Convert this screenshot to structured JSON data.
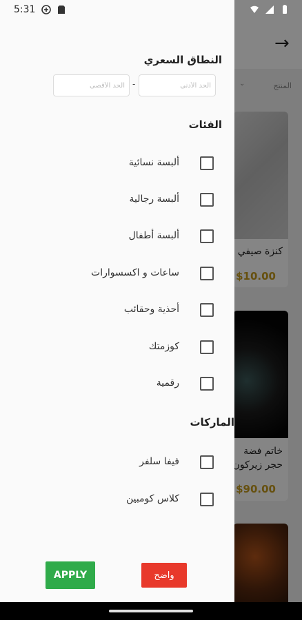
{
  "status_bar": {
    "time": "5:31",
    "left_icons": [
      "gamepad-icon",
      "sim-card-icon"
    ],
    "right_icons": [
      "wifi-icon",
      "cellular-signal-icon",
      "battery-icon"
    ]
  },
  "background": {
    "back_arrow": "→",
    "filter_label": "المنتج",
    "products": [
      {
        "title": "كنزة صيفي",
        "price": "$10.00"
      },
      {
        "title_line1": "خاتم فضة",
        "title_line2": "حجر زيركون",
        "price": "$90.00"
      }
    ]
  },
  "drawer": {
    "price_range": {
      "title": "النطاق السعري",
      "min_placeholder": "الحد الأدنى",
      "max_placeholder": "الحد الأقصى",
      "separator": "-"
    },
    "categories": {
      "title": "الفئات",
      "items": [
        {
          "label": "ألبسة نسائية",
          "checked": false
        },
        {
          "label": "ألبسة رجالية",
          "checked": false
        },
        {
          "label": "ألبسة أطفال",
          "checked": false
        },
        {
          "label": "ساعات و اكسسوارات",
          "checked": false
        },
        {
          "label": "أحذية وحقائب",
          "checked": false
        },
        {
          "label": "كوزمتك",
          "checked": false
        },
        {
          "label": "رقمية",
          "checked": false
        }
      ]
    },
    "brands": {
      "title": "الماركات",
      "items": [
        {
          "label": "فيفا سلفر",
          "checked": false
        },
        {
          "label": "كلاس كومبين",
          "checked": false
        }
      ]
    },
    "buttons": {
      "apply": "APPLY",
      "clear": "واضح"
    }
  },
  "colors": {
    "apply_green": "#2fab4a",
    "clear_red": "#e8392b",
    "price_gold": "#c49a1e"
  }
}
